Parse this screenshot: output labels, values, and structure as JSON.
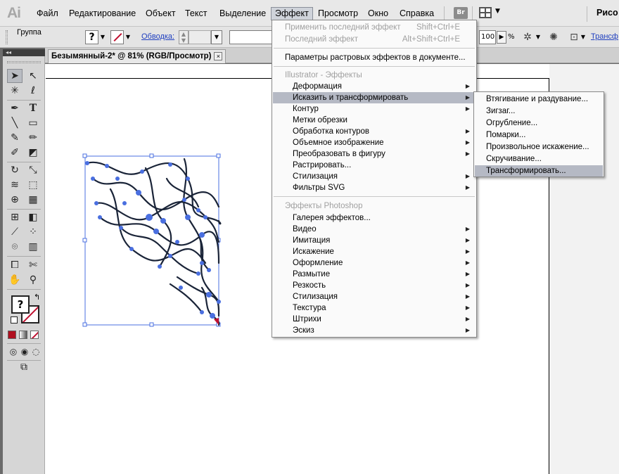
{
  "app": {
    "logo": "Ai",
    "workspace": "Рисо",
    "bridge_badge": "Br"
  },
  "menubar": {
    "items": [
      "Файл",
      "Редактирование",
      "Объект",
      "Текст",
      "Выделение",
      "Эффект",
      "Просмотр",
      "Окно",
      "Справка"
    ],
    "active": "Эффект"
  },
  "control": {
    "selection_label": "Группа",
    "fill_symbol": "?",
    "stroke_link": "Обводка:",
    "opacity_value": "100",
    "opacity_unit": "%",
    "transform_link": "Трансф"
  },
  "document": {
    "tab_title": "Безымянный-2* @ 81% (RGB/Просмотр)",
    "close_symbol": "×"
  },
  "tools": {
    "collapse_symbol": "◂◂",
    "fill_symbol": "?",
    "swap_symbol": "↰"
  },
  "effect_menu": {
    "apply_last": {
      "label": "Применить последний эффект",
      "shortcut": "Shift+Ctrl+E"
    },
    "last_effect": {
      "label": "Последний эффект",
      "shortcut": "Alt+Shift+Ctrl+E"
    },
    "raster_settings": "Параметры растровых эффектов в документе...",
    "illustrator_header": "Illustrator - Эффекты",
    "illustrator_items": [
      {
        "label": "Деформация",
        "submenu": true
      },
      {
        "label": "Исказить и трансформировать",
        "submenu": true,
        "highlighted": true
      },
      {
        "label": "Контур",
        "submenu": true
      },
      {
        "label": "Метки обрезки",
        "submenu": false
      },
      {
        "label": "Обработка контуров",
        "submenu": true
      },
      {
        "label": "Объемное изображение",
        "submenu": true
      },
      {
        "label": "Преобразовать в фигуру",
        "submenu": true
      },
      {
        "label": "Растрировать...",
        "submenu": false
      },
      {
        "label": "Стилизация",
        "submenu": true
      },
      {
        "label": "Фильтры SVG",
        "submenu": true
      }
    ],
    "photoshop_header": "Эффекты Photoshop",
    "photoshop_items": [
      {
        "label": "Галерея эффектов...",
        "submenu": false
      },
      {
        "label": "Видео",
        "submenu": true
      },
      {
        "label": "Имитация",
        "submenu": true
      },
      {
        "label": "Искажение",
        "submenu": true
      },
      {
        "label": "Оформление",
        "submenu": true
      },
      {
        "label": "Размытие",
        "submenu": true
      },
      {
        "label": "Резкость",
        "submenu": true
      },
      {
        "label": "Стилизация",
        "submenu": true
      },
      {
        "label": "Текстура",
        "submenu": true
      },
      {
        "label": "Штрихи",
        "submenu": true
      },
      {
        "label": "Эскиз",
        "submenu": true
      }
    ]
  },
  "distort_submenu": {
    "items": [
      {
        "label": "Втягивание и раздувание..."
      },
      {
        "label": "Зигзаг..."
      },
      {
        "label": "Огрубление..."
      },
      {
        "label": "Помарки..."
      },
      {
        "label": "Произвольное искажение..."
      },
      {
        "label": "Скручивание..."
      },
      {
        "label": "Трансформировать...",
        "highlighted": true
      }
    ]
  },
  "colors": {
    "menu_highlight": "#b5b9c4",
    "selection_blue": "#4a6fe0",
    "path_dark": "#1a2438",
    "stroke_red": "#c01030"
  }
}
